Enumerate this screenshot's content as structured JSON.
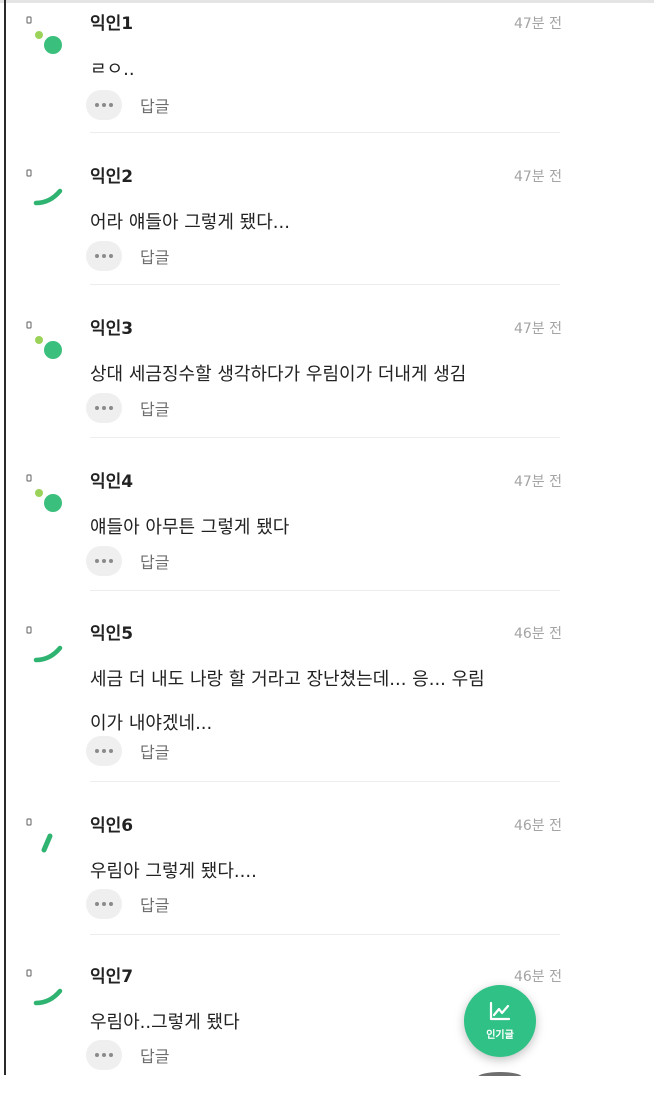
{
  "comments": [
    {
      "author": "익인1",
      "time": "47분 전",
      "lines": [
        "ㄹㅇ.."
      ],
      "reply_label": "답글",
      "avatar": "dots-avatar-icon"
    },
    {
      "author": "익인2",
      "time": "47분 전",
      "lines": [
        "어라 얘들아 그렇게 됐다..."
      ],
      "reply_label": "답글",
      "avatar": "curve-avatar-icon"
    },
    {
      "author": "익인3",
      "time": "47분 전",
      "lines": [
        "상대 세금징수할 생각하다가 우림이가 더내게 생김"
      ],
      "reply_label": "답글",
      "avatar": "dots-avatar-icon"
    },
    {
      "author": "익인4",
      "time": "47분 전",
      "lines": [
        "얘들아 아무튼 그렇게 됐다"
      ],
      "reply_label": "답글",
      "avatar": "dots-avatar-icon"
    },
    {
      "author": "익인5",
      "time": "46분 전",
      "lines": [
        "세금 더 내도 나랑 할 거라고 장난쳤는데... 응... 우림",
        "이가 내야겠네..."
      ],
      "reply_label": "답글",
      "avatar": "curve-avatar-icon"
    },
    {
      "author": "익인6",
      "time": "46분 전",
      "lines": [
        "우림아 그렇게 됐다...."
      ],
      "reply_label": "답글",
      "avatar": "slash-avatar-icon"
    },
    {
      "author": "익인7",
      "time": "46분 전",
      "lines": [
        "우림아..그렇게 됐다"
      ],
      "reply_label": "답글",
      "avatar": "curve-avatar-icon"
    }
  ],
  "fab": {
    "label": "인기글",
    "icon": "trending-chart-icon"
  },
  "colors": {
    "accent": "#2fc185",
    "avatar_dot_light": "#9bd35a",
    "avatar_dot_green": "#3bbf7d",
    "time": "#a4a4a4"
  }
}
